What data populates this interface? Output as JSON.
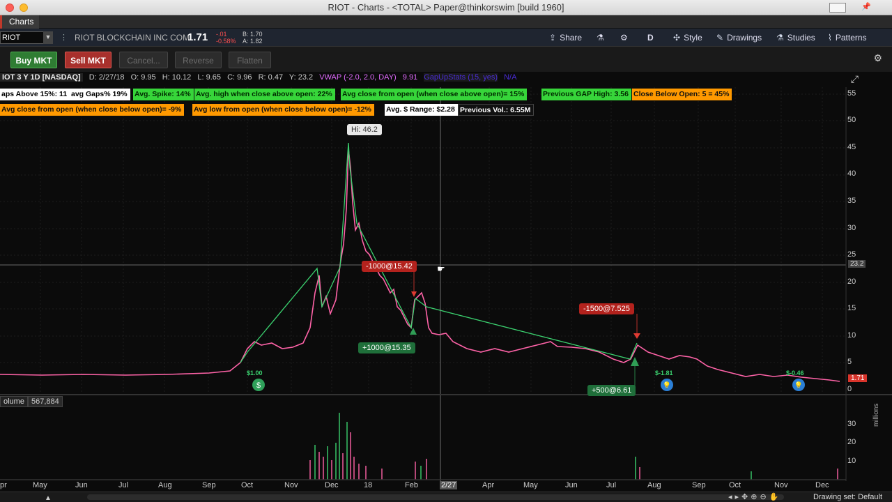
{
  "window": {
    "title": "RIOT - Charts - <TOTAL> Paper@thinkorswim [build 1960]",
    "tab": "Charts"
  },
  "symbol": {
    "ticker": "RIOT",
    "company": "RIOT BLOCKCHAIN INC COM",
    "last": "1.71",
    "change": "-.01",
    "change_pct": "-0.58%",
    "bid": "B: 1.70",
    "ask": "A: 1.82"
  },
  "toolbar": {
    "share": "Share",
    "period": "D",
    "style": "Style",
    "drawings": "Drawings",
    "studies": "Studies",
    "patterns": "Patterns"
  },
  "order_buttons": {
    "buy": "Buy MKT",
    "sell": "Sell MKT",
    "cancel": "Cancel...",
    "reverse": "Reverse",
    "flatten": "Flatten"
  },
  "info": {
    "period": "IOT 3 Y 1D [NASDAQ]",
    "date": "D: 2/27/18",
    "open": "O: 9.95",
    "high": "H: 10.12",
    "low": "L: 9.65",
    "close": "C: 9.96",
    "range": "R: 0.47",
    "y": "Y: 23.2",
    "vwap": "VWAP (-2.0, 2.0, DAY)",
    "vwap_val": "9.91",
    "gapup": "GapUpStats (15, yes)",
    "na": "N/A"
  },
  "stats_row1": [
    "aps Above 15%: 11",
    "avg Gaps%  19%",
    "Avg. Spike: 14%",
    "Avg. high when close above open: 22%",
    "Avg close from open (when close above open)=  15%",
    "Previous GAP High: 3.56",
    "Close Below Open: 5 = 45%"
  ],
  "stats_row2": [
    "Avg close from open (when close below open)=  -9%",
    "Avg low from open (when close below open)= -12%",
    "Avg. $ Range: $2.28",
    "Previous Vol.: 6.55M"
  ],
  "callouts": {
    "hi": "Hi: 46.2",
    "sell1": "-1000@15.42",
    "buy1": "+1000@15.35",
    "sell2": "-1500@7.525",
    "buy2": "+500@6.61",
    "div1": "$1.00",
    "e1": "$-1.81",
    "e2": "$-0.46"
  },
  "price_axis": [
    "55",
    "50",
    "45",
    "40",
    "35",
    "30",
    "25",
    "20",
    "15",
    "10",
    "5",
    "0"
  ],
  "cursor_price": "23.2",
  "last_price_tag": "1.71",
  "volume": {
    "label": "olume",
    "value": "567,884",
    "axis": [
      "30",
      "20",
      "10"
    ],
    "unit": "millions"
  },
  "x_axis": [
    "pr",
    "May",
    "Jun",
    "Jul",
    "Aug",
    "Sep",
    "Oct",
    "Nov",
    "Dec",
    "18",
    "Feb",
    "2/27",
    "Apr",
    "May",
    "Jun",
    "Jul",
    "Aug",
    "Sep",
    "Oct",
    "Nov",
    "Dec"
  ],
  "status": {
    "drawing_set": "Drawing set: Default"
  },
  "colors": {
    "up": "#3bd16f",
    "down": "#ff5fa3",
    "buy_btn": "#2f7d33",
    "sell_btn": "#a8302c"
  }
}
